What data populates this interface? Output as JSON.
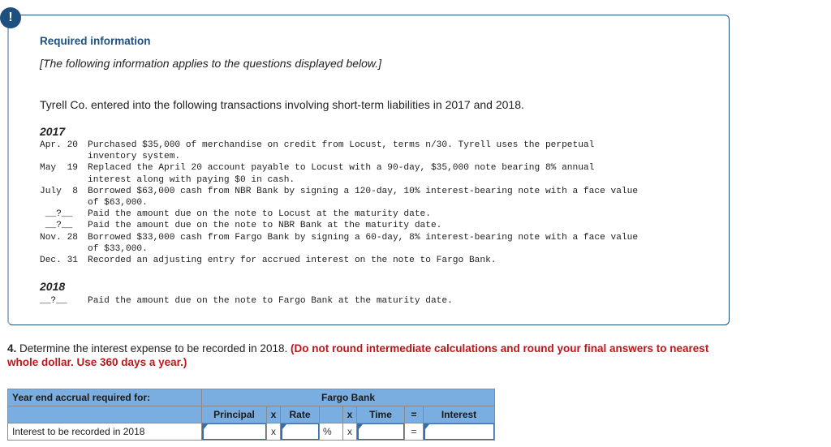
{
  "info": {
    "alert_icon": "!",
    "title": "Required information",
    "subtitle": "[The following information applies to the questions displayed below.]",
    "intro": "Tyrell Co. entered into the following transactions involving short-term liabilities in 2017 and 2018."
  },
  "transactions_2017": {
    "year": "2017",
    "items": [
      {
        "date": "Apr. 20",
        "lines": [
          "Purchased $35,000 of merchandise on credit from Locust, terms n/30. Tyrell uses the perpetual",
          "inventory system."
        ]
      },
      {
        "date": "May  19",
        "lines": [
          "Replaced the April 20 account payable to Locust with a 90-day, $35,000 note bearing 8% annual",
          "interest along with paying $0 in cash."
        ]
      },
      {
        "date": "July  8",
        "lines": [
          "Borrowed $63,000 cash from NBR Bank by signing a 120-day, 10% interest-bearing note with a face value",
          "of $63,000."
        ]
      },
      {
        "date": " __?__",
        "lines": [
          "Paid the amount due on the note to Locust at the maturity date."
        ]
      },
      {
        "date": " __?__",
        "lines": [
          "Paid the amount due on the note to NBR Bank at the maturity date."
        ]
      },
      {
        "date": "Nov. 28",
        "lines": [
          "Borrowed $33,000 cash from Fargo Bank by signing a 60-day, 8% interest-bearing note with a face value",
          "of $33,000."
        ]
      },
      {
        "date": "Dec. 31",
        "lines": [
          "Recorded an adjusting entry for accrued interest on the note to Fargo Bank."
        ]
      }
    ]
  },
  "transactions_2018": {
    "year": "2018",
    "items": [
      {
        "date": "__?__",
        "lines": [
          "Paid the amount due on the note to Fargo Bank at the maturity date."
        ]
      }
    ]
  },
  "question": {
    "number": "4.",
    "text": " Determine the interest expense to be recorded in 2018. ",
    "instruction": "(Do not round intermediate calculations and round your final answers to nearest whole dollar. Use 360 days a year.)"
  },
  "table": {
    "header_label": "Year end accrual required for:",
    "group_header": "Fargo Bank",
    "columns": {
      "principal": "Principal",
      "op1": "x",
      "rate": "Rate",
      "rate_unit": "",
      "op2": "x",
      "time": "Time",
      "op3": "=",
      "interest": "Interest"
    },
    "row": {
      "label": "Interest to be recorded in 2018",
      "op1": "x",
      "rate_unit": "%",
      "op2": "x",
      "op3": "=",
      "principal_value": "",
      "rate_value": "",
      "time_value": "",
      "interest_value": ""
    }
  }
}
